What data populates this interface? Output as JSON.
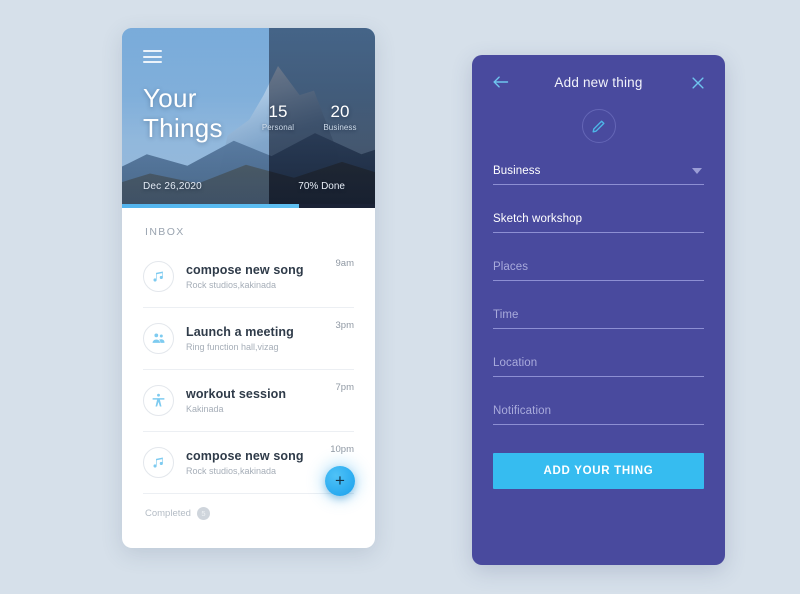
{
  "theme": {
    "page_background": "#d6e0ea",
    "accent_blue": "#36bcf0",
    "modal_purple": "#494a9e",
    "icon_blue": "#7ecbf0"
  },
  "left_phone": {
    "menu_icon": "hamburger-menu-icon",
    "header": {
      "title_line1": "Your",
      "title_line2": "Things",
      "date": "Dec 26,2020",
      "done_label": "70% Done",
      "progress_percent": 70,
      "stats": [
        {
          "value": "15",
          "label": "Personal"
        },
        {
          "value": "20",
          "label": "Business"
        }
      ]
    },
    "section_label": "INBOX",
    "tasks": [
      {
        "icon": "music-note-icon",
        "title": "compose new song",
        "subtitle": "Rock studios,kakinada",
        "time": "9am"
      },
      {
        "icon": "people-group-icon",
        "title": "Launch a meeting",
        "subtitle": "Ring function hall,vizag",
        "time": "3pm"
      },
      {
        "icon": "accessibility-person-icon",
        "title": "workout  session",
        "subtitle": "Kakinada",
        "time": "7pm"
      },
      {
        "icon": "music-note-icon",
        "title": "compose new song",
        "subtitle": "Rock studios,kakinada",
        "time": "10pm"
      }
    ],
    "completed": {
      "label": "Completed",
      "count": "5"
    },
    "fab": {
      "icon": "plus-icon",
      "label": "+"
    }
  },
  "right_phone": {
    "topbar": {
      "back_icon": "arrow-left-icon",
      "title": "Add new thing",
      "close_icon": "close-icon"
    },
    "edit_icon": "pencil-edit-icon",
    "fields": [
      {
        "name": "category",
        "value": "Business",
        "state": "filled",
        "has_dropdown": true
      },
      {
        "name": "thing-name",
        "value": "Sketch workshop",
        "state": "filled",
        "has_dropdown": false
      },
      {
        "name": "places",
        "value": "Places",
        "state": "placeholder",
        "has_dropdown": false
      },
      {
        "name": "time",
        "value": "Time",
        "state": "placeholder",
        "has_dropdown": false
      },
      {
        "name": "location",
        "value": "Location",
        "state": "placeholder",
        "has_dropdown": false
      },
      {
        "name": "notification",
        "value": "Notification",
        "state": "placeholder",
        "has_dropdown": false
      }
    ],
    "submit_label": "ADD YOUR THING"
  }
}
